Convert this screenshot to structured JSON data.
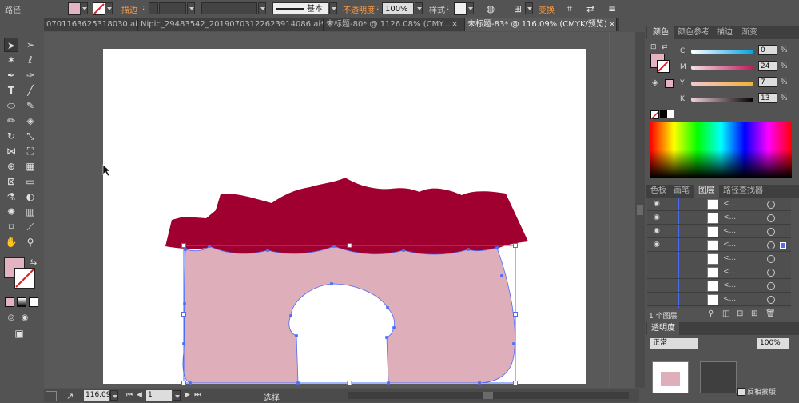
{
  "control_bar": {
    "object_type": "路径",
    "stroke_label": "描边",
    "stroke_profile": "基本",
    "opacity_label": "不透明度",
    "opacity_value": "100%",
    "style_label": "样式",
    "transform_label": "变换",
    "fill_color": "#e3b3c1"
  },
  "tabs": [
    {
      "label": "0701163625318030.ai*",
      "active": false
    },
    {
      "label": "Nipic_29483542_20190703122623914086.ai*",
      "active": false
    },
    {
      "label": "未标题-80* @ 1126.08% (CMY...",
      "active": false
    },
    {
      "label": "未标题-83* @ 116.09% (CMYK/预览)",
      "active": true
    }
  ],
  "tools": [
    "selection-tool",
    "direct-selection-tool",
    "magic-wand-tool",
    "lasso-tool",
    "pen-tool",
    "curvature-tool",
    "type-tool",
    "line-tool",
    "ellipse-tool",
    "paintbrush-tool",
    "pencil-tool",
    "eraser-tool",
    "rotate-tool",
    "scale-tool",
    "width-tool",
    "free-transform-tool",
    "shape-builder-tool",
    "perspective-grid-tool",
    "mesh-tool",
    "gradient-tool",
    "eyedropper-tool",
    "blend-tool",
    "symbol-sprayer-tool",
    "column-graph-tool",
    "artboard-tool",
    "slice-tool",
    "hand-tool",
    "zoom-tool"
  ],
  "colors": {
    "roof": "#a0002f",
    "wall": "#dfaebb",
    "selection": "#4a6cf7"
  },
  "status_bar": {
    "zoom": "116.09",
    "artboard_number": "1",
    "status_text": "选择"
  },
  "color_panel": {
    "tabs": [
      "颜色",
      "颜色参考",
      "描边",
      "渐变"
    ],
    "channels": [
      {
        "name": "C",
        "value": "0",
        "unit": "%"
      },
      {
        "name": "M",
        "value": "24",
        "unit": "%"
      },
      {
        "name": "Y",
        "value": "7",
        "unit": "%"
      },
      {
        "name": "K",
        "value": "13",
        "unit": "%"
      }
    ]
  },
  "layers_panel": {
    "tabs": [
      "色板",
      "画笔",
      "图层",
      "路径查找器"
    ],
    "rows": [
      {
        "name": "<...",
        "visible": true
      },
      {
        "name": "<...",
        "visible": true
      },
      {
        "name": "<...",
        "visible": true
      },
      {
        "name": "<...",
        "visible": true
      },
      {
        "name": "<...",
        "visible": false
      },
      {
        "name": "<...",
        "visible": false
      },
      {
        "name": "<...",
        "visible": false
      },
      {
        "name": "<...",
        "visible": false
      }
    ],
    "footer_count": "1 个图层"
  },
  "transparency_panel": {
    "title": "透明度",
    "blend_mode": "正常",
    "opacity": "100%",
    "invert_mask_label": "反相蒙版"
  }
}
